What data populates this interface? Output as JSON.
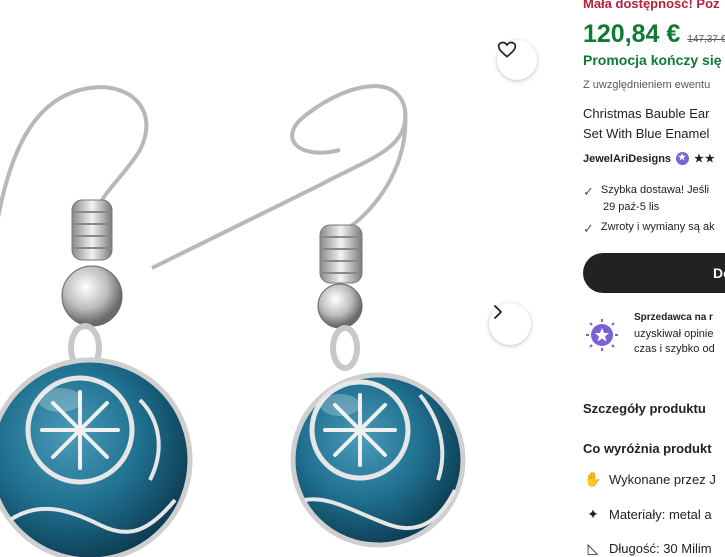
{
  "gallery": {
    "favorite_icon": "heart-outline-icon",
    "next_icon": "chevron-right-icon"
  },
  "listing": {
    "stock_notice": "Mała dostępność! Poz",
    "price": "120,84 €",
    "original_price": "147,37 €",
    "promo": "Promocja kończy się z",
    "tax_note": "Z uwzględnieniem ewentu",
    "title_line1": "Christmas Bauble Ear",
    "title_line2": "Set With Blue Enamel",
    "shop_name": "JewelAriDesigns",
    "stars": "★★",
    "shipping_line1": "Szybka dostawa! Jeśli",
    "shipping_line2": "29 paź-5 lis",
    "returns": "Zwroty i wymiany są ak",
    "cart_button": "Do"
  },
  "seller": {
    "line1": "Sprzedawca na r",
    "line2": "uzyskiwał opinie",
    "line3": "czas i szybko od"
  },
  "sections": {
    "details_heading": "Szczegóły produktu",
    "highlights_heading": "Co wyróżnia produkt",
    "features": [
      {
        "icon": "hand-icon",
        "text": "Wykonane przez J"
      },
      {
        "icon": "sparkle-icon",
        "text": "Materiały: metal a"
      },
      {
        "icon": "ruler-icon",
        "text": "Długość: 30 Milim"
      }
    ]
  },
  "colors": {
    "price_green": "#0e7a33",
    "stock_red": "#b3203b",
    "badge_purple": "#7b61d6",
    "enamel_blue": "#1f6f8f"
  }
}
